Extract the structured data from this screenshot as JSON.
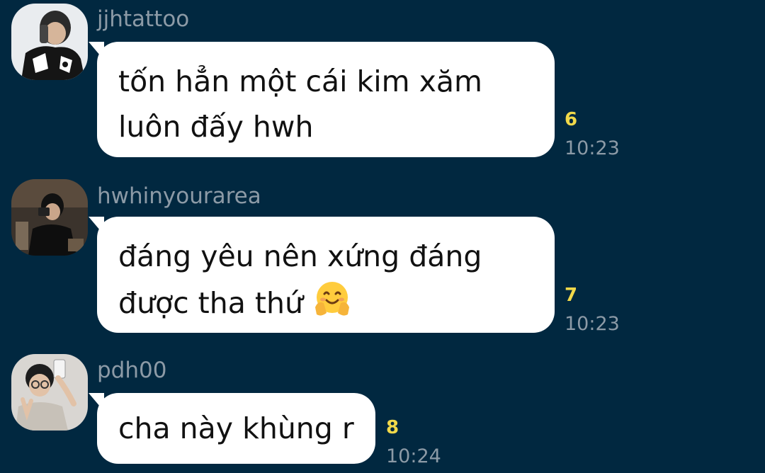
{
  "messages": [
    {
      "sender": "jjhtattoo",
      "lines": [
        "tốn hẳn một cái kim xăm",
        "luôn đấy hwh"
      ],
      "unread_count": "6",
      "time": "10:23"
    },
    {
      "sender": "hwhinyourarea",
      "lines": [
        "đáng yêu nên xứng đáng",
        "được tha thứ"
      ],
      "emoji": "hugging-face-emoji",
      "unread_count": "7",
      "time": "10:23"
    },
    {
      "sender": "pdh00",
      "lines": [
        "cha này khùng r"
      ],
      "unread_count": "8",
      "time": "10:24"
    }
  ],
  "colors": {
    "background": "#012840",
    "bubble": "#ffffff",
    "unread_count": "#f1d94a",
    "secondary_text": "#8c9aa6"
  }
}
